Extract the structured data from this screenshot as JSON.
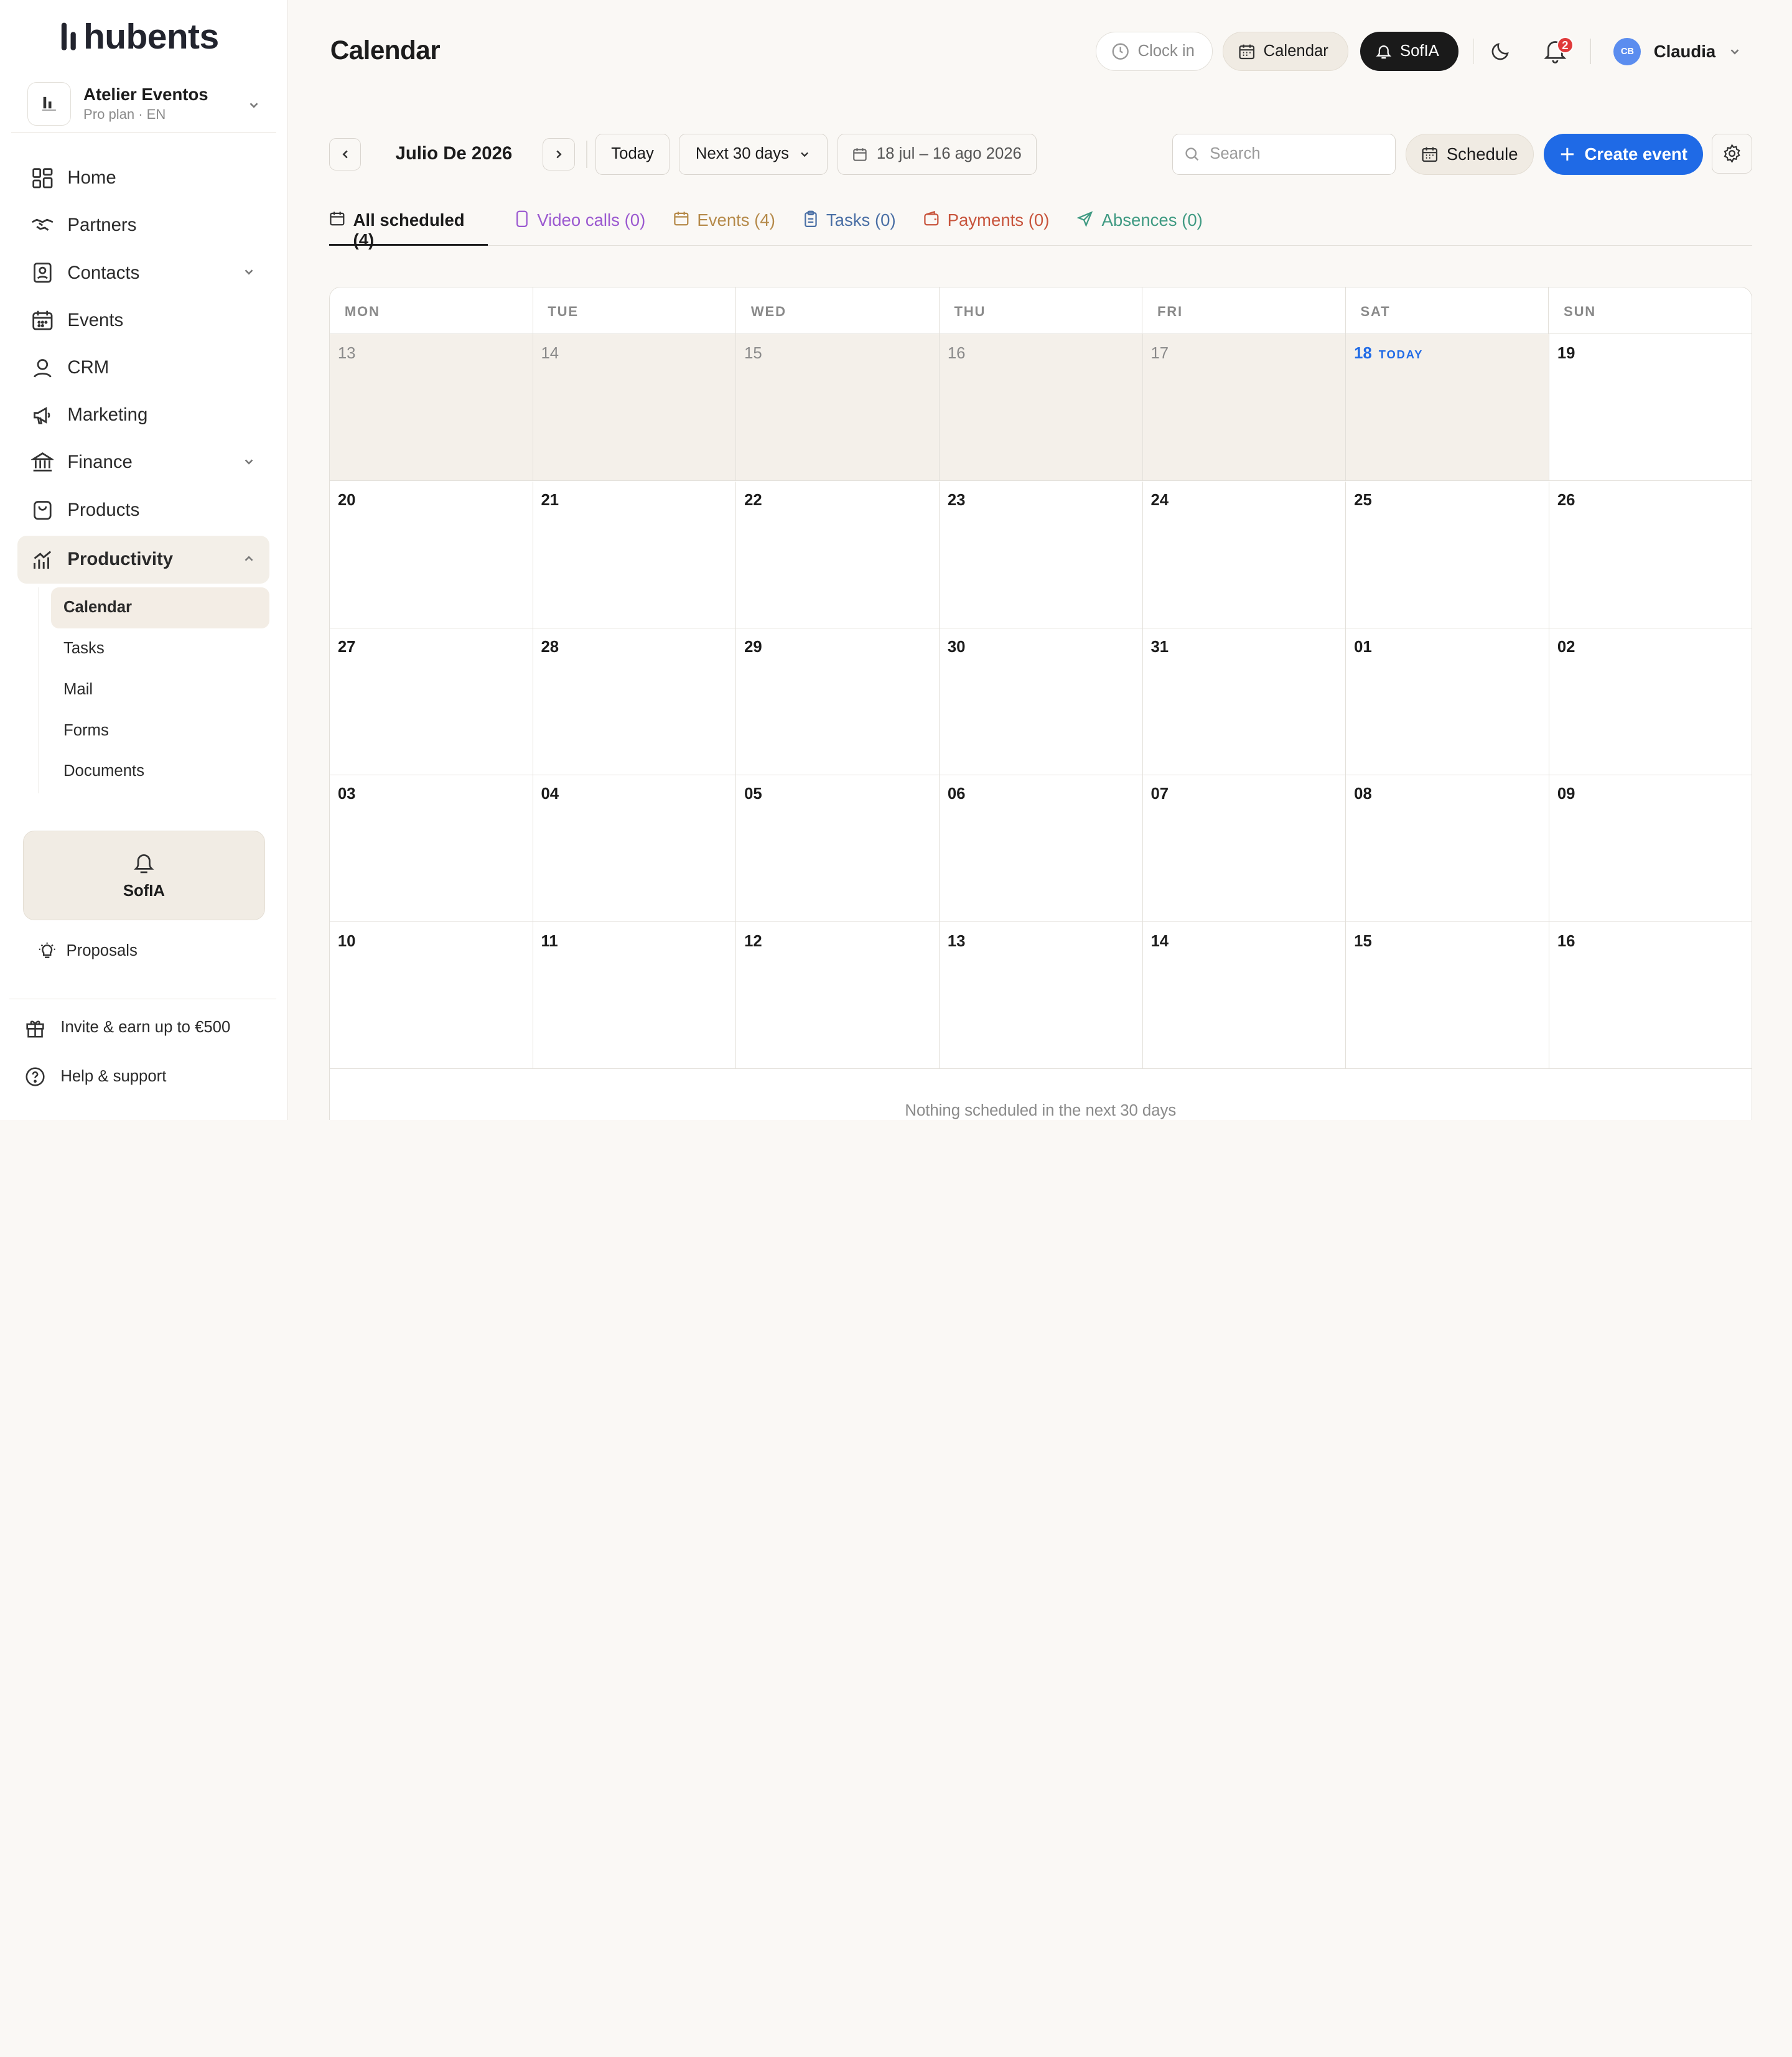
{
  "brand": {
    "logo_text": "hubents"
  },
  "org": {
    "name": "Atelier Eventos",
    "plan": "Pro plan · EN"
  },
  "sidebar": {
    "items": [
      {
        "label": "Home",
        "icon": "grid-icon"
      },
      {
        "label": "Partners",
        "icon": "handshake-icon"
      },
      {
        "label": "Contacts",
        "icon": "contacts-icon"
      },
      {
        "label": "Events",
        "icon": "calendar-icon"
      },
      {
        "label": "CRM",
        "icon": "user-icon"
      },
      {
        "label": "Marketing",
        "icon": "megaphone-icon"
      },
      {
        "label": "Finance",
        "icon": "bank-icon"
      },
      {
        "label": "Products",
        "icon": "bag-icon"
      },
      {
        "label": "Productivity",
        "icon": "chart-icon"
      }
    ],
    "sub_items": [
      "Calendar",
      "Tasks",
      "Mail",
      "Forms",
      "Documents"
    ],
    "sofia_label": "SofIA",
    "proposals_label": "Proposals",
    "invite_label": "Invite & earn up to €500",
    "help_label": "Help & support"
  },
  "header": {
    "title": "Calendar",
    "clock_in": "Clock in",
    "calendar": "Calendar",
    "sofia": "SofIA",
    "notifications_count": "2",
    "user_initials": "CB",
    "user_name": "Claudia"
  },
  "toolbar": {
    "month": "Julio De 2026",
    "today": "Today",
    "range_select": "Next 30 days",
    "date_range": "18 jul – 16 ago 2026",
    "search_placeholder": "Search",
    "schedule": "Schedule",
    "create_event": "Create event"
  },
  "tabs": [
    {
      "label": "All scheduled (4)",
      "color": "#1c1c1c"
    },
    {
      "label": "Video calls (0)",
      "color": "#9b59d0"
    },
    {
      "label": "Events (4)",
      "color": "#b58a4a"
    },
    {
      "label": "Tasks (0)",
      "color": "#4a6fa5"
    },
    {
      "label": "Payments (0)",
      "color": "#c8553d"
    },
    {
      "label": "Absences (0)",
      "color": "#3f9a82"
    }
  ],
  "calendar": {
    "weekdays": [
      "MON",
      "TUE",
      "WED",
      "THU",
      "FRI",
      "SAT",
      "SUN"
    ],
    "weeks": [
      [
        "13",
        "14",
        "15",
        "16",
        "17",
        "18",
        "19"
      ],
      [
        "20",
        "21",
        "22",
        "23",
        "24",
        "25",
        "26"
      ],
      [
        "27",
        "28",
        "29",
        "30",
        "31",
        "01",
        "02"
      ],
      [
        "03",
        "04",
        "05",
        "06",
        "07",
        "08",
        "09"
      ],
      [
        "10",
        "11",
        "12",
        "13",
        "14",
        "15",
        "16"
      ]
    ],
    "past_days": 5,
    "today_index": 5,
    "today_label": "TODAY",
    "empty_message": "Nothing scheduled in the next 30 days"
  },
  "colors": {
    "accent": "#1f6ae6",
    "badge": "#e03a3a",
    "past_bg": "#f4f0ea"
  }
}
